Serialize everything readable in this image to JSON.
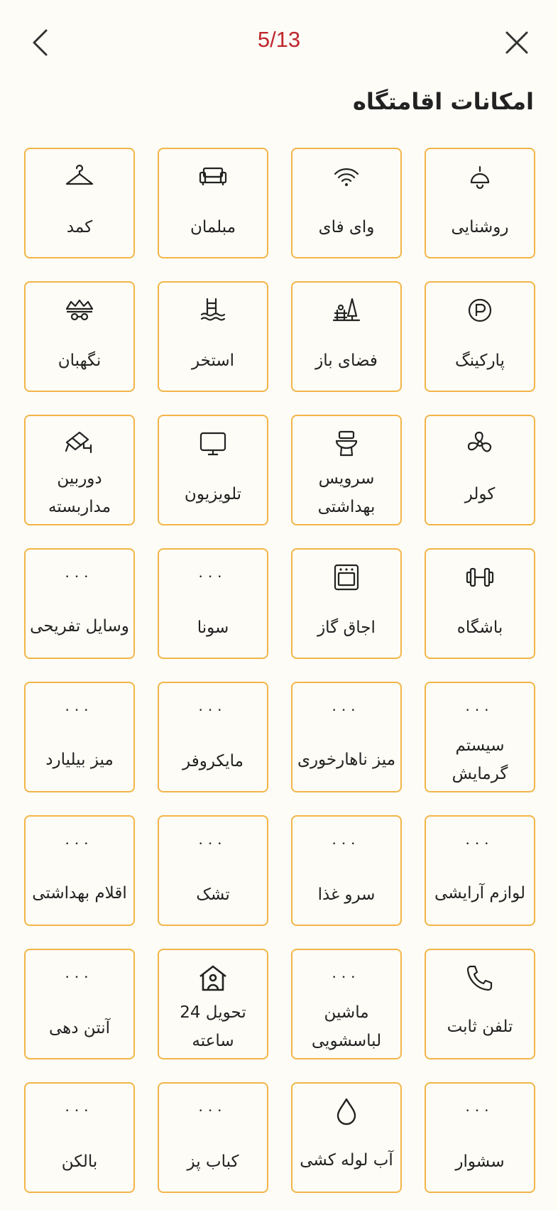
{
  "header": {
    "counter": "5/13",
    "title": "امکانات اقامتگاه",
    "back_icon": "chevron-left-icon",
    "close_icon": "close-icon"
  },
  "colors": {
    "accent": "#f3b548",
    "counter": "#c0262d",
    "background": "#fdfcf6"
  },
  "amenities": [
    {
      "label": "روشنایی",
      "icon": "lamp-icon"
    },
    {
      "label": "وای فای",
      "icon": "wifi-icon"
    },
    {
      "label": "مبلمان",
      "icon": "sofa-icon"
    },
    {
      "label": "کمد",
      "icon": "hanger-icon"
    },
    {
      "label": "پارکینگ",
      "icon": "parking-icon"
    },
    {
      "label": "فضای باز",
      "icon": "outdoor-icon"
    },
    {
      "label": "استخر",
      "icon": "pool-icon"
    },
    {
      "label": "نگهبان",
      "icon": "guard-icon"
    },
    {
      "label": "کولر",
      "icon": "fan-icon"
    },
    {
      "label": "سرویس بهداشتی",
      "icon": "toilet-icon"
    },
    {
      "label": "تلویزیون",
      "icon": "tv-icon"
    },
    {
      "label": "دوربین مداربسته",
      "icon": "cctv-icon"
    },
    {
      "label": "باشگاه",
      "icon": "dumbbell-icon"
    },
    {
      "label": "اجاق گاز",
      "icon": "oven-icon"
    },
    {
      "label": "سونا",
      "icon": "more-icon"
    },
    {
      "label": "وسایل تفریحی",
      "icon": "more-icon"
    },
    {
      "label": "سیستم گرمایش",
      "icon": "more-icon"
    },
    {
      "label": "میز ناهارخوری",
      "icon": "more-icon"
    },
    {
      "label": "مایکروفر",
      "icon": "more-icon"
    },
    {
      "label": "میز بیلیارد",
      "icon": "more-icon"
    },
    {
      "label": "لوازم آرایشی",
      "icon": "more-icon"
    },
    {
      "label": "سرو غذا",
      "icon": "more-icon"
    },
    {
      "label": "تشک",
      "icon": "more-icon"
    },
    {
      "label": "اقلام بهداشتی",
      "icon": "more-icon"
    },
    {
      "label": "تلفن ثابت",
      "icon": "phone-icon"
    },
    {
      "label": "ماشین لباسشویی",
      "icon": "more-icon"
    },
    {
      "label": "تحویل 24 ساعته",
      "icon": "home-user-icon"
    },
    {
      "label": "آنتن دهی",
      "icon": "more-icon"
    },
    {
      "label": "سشوار",
      "icon": "more-icon"
    },
    {
      "label": "آب لوله کشی",
      "icon": "water-drop-icon"
    },
    {
      "label": "کباب پز",
      "icon": "more-icon"
    },
    {
      "label": "بالکن",
      "icon": "more-icon"
    }
  ]
}
